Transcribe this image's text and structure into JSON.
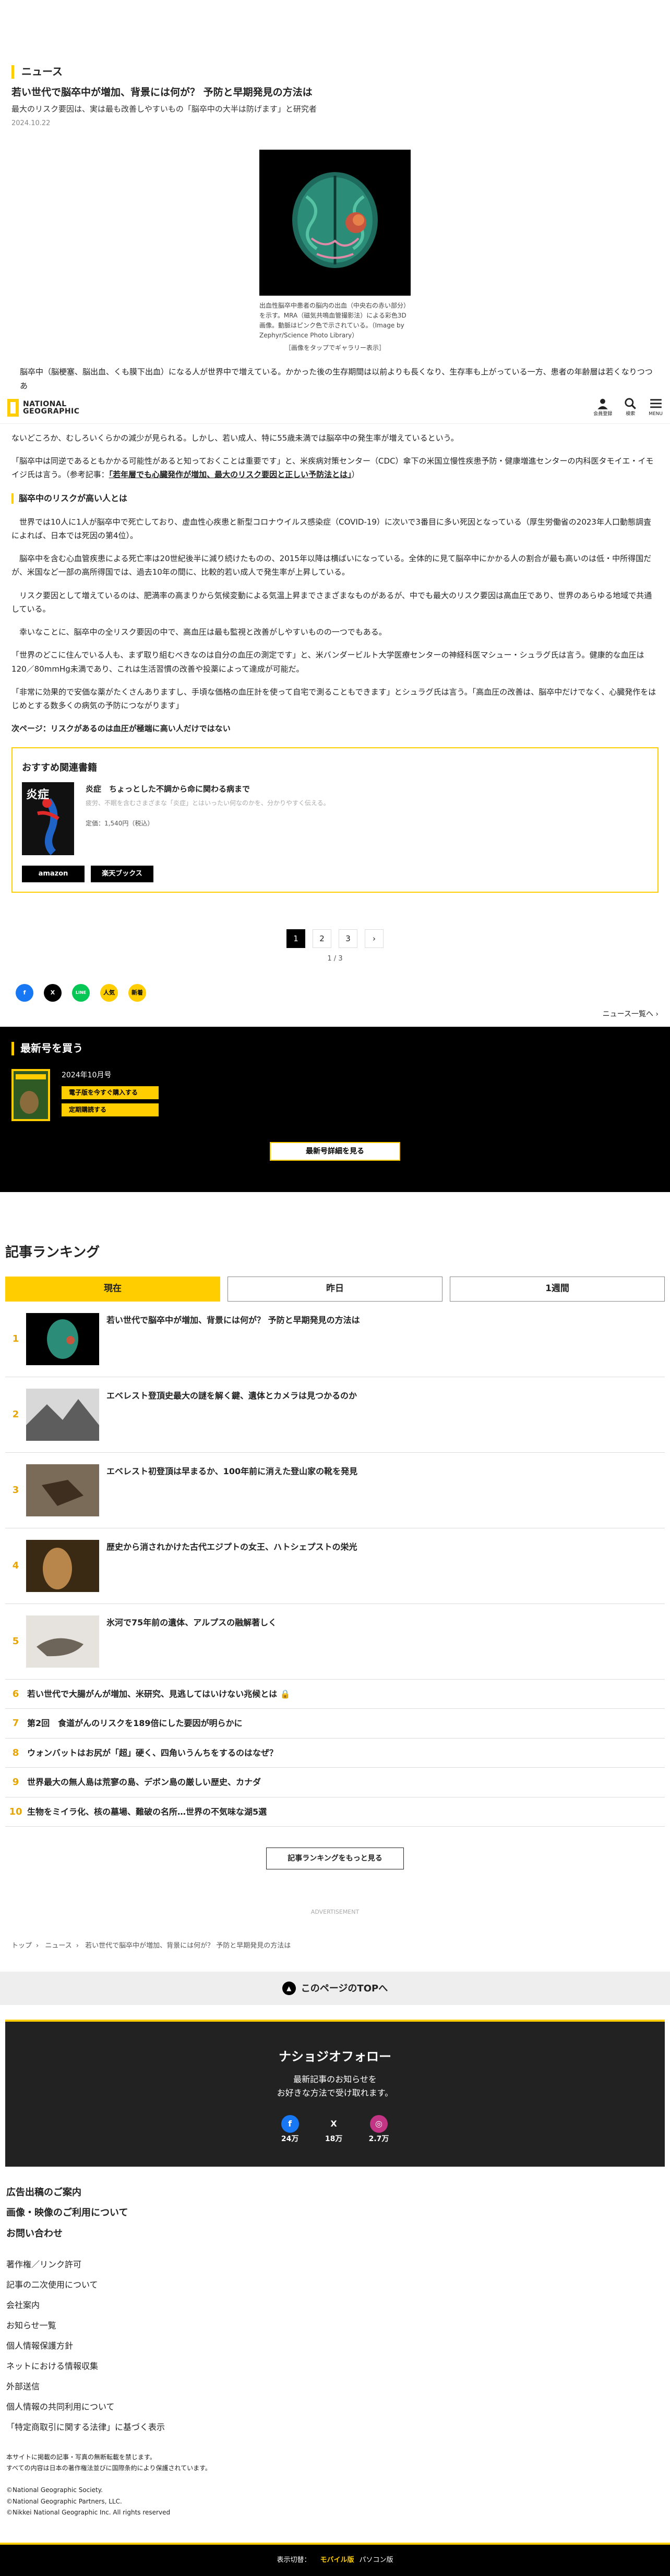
{
  "section_label": "ニュース",
  "article": {
    "title": "若い世代で脳卒中が増加、背景には何が？ 予防と早期発見の方法は",
    "subtitle": "最大のリスク要因は、実は最も改善しやすいもの「脳卒中の大半は防げます」と研究者",
    "date": "2024.10.22",
    "figure_caption": "出血性脳卒中患者の脳内の出血（中央右の赤い部分）を示す。MRA（磁気共鳴血管撮影法）による彩色3D画像。動脈はピンク色で示されている。（Image by Zephyr/Science Photo Library）",
    "figure_caption_2": "［画像をタップでギャラリー表示］",
    "lead": "脳卒中（脳梗塞、脳出血、くも膜下出血）になる人が世界中で増えている。かかった後の生存期間は以前よりも長くなり、生存率も上がっている一方、患者の年齢層は若くなりつつあ",
    "p1": "ないどころか、むしろいくらかの減少が見られる。しかし、若い成人、特に55歳未満では脳卒中の発生率が増えているという。",
    "p2_a": "「脳卒中は同逆であるともかかる可能性があると知っておくことは重要です」と、米疾病対策センター（CDC）傘下の米国立慢性疾患予防・健康増進センターの内科医タモイエ・イモイジ氏は言う。（参考記事：",
    "p2_link": "「若年層でも心臓発作が増加、最大のリスク要因と正しい予防法とは」",
    "p2_b": "）",
    "p3": "世界では10人に1人が脳卒中で死亡しており、虚血性心疾患と新型コロナウイルス感染症（COVID-19）に次いで3番目に多い死因となっている（厚生労働省の2023年人口動態調査によれば、日本では死因の第4位）。",
    "p4": "脳卒中を含む心血管疾患による死亡率は20世紀後半に減り続けたものの、2015年以降は横ばいになっている。全体的に見て脳卒中にかかる人の割合が最も高いのは低・中所得国だが、米国など一部の高所得国では、過去10年の間に、比較的若い成人で発生率が上昇している。",
    "p5": "リスク要因として増えているのは、肥満率の高まりから気候変動による気温上昇までさまざまなものがあるが、中でも最大のリスク要因は高血圧であり、世界のあらゆる地域で共通している。",
    "sub_heading": "脳卒中のリスクが高い人とは",
    "p6": "幸いなことに、脳卒中の全リスク要因の中で、高血圧は最も監視と改善がしやすいものの一つでもある。",
    "p7": "「世界のどこに住んでいる人も、まず取り組むべきなのは自分の血圧の測定です」と、米バンダービルト大学医療センターの神経科医マシュー・シュラグ氏は言う。健康的な血圧は120／80mmHg未満であり、これは生活習慣の改善や投薬によって達成が可能だ。",
    "p8": "「非常に効果的で安価な薬がたくさんありますし、手頃な価格の血圧計を使って自宅で測ることもできます」とシュラグ氏は言う。「高血圧の改善は、脳卒中だけでなく、心臓発作をはじめとする数多くの病気の予防につながります」",
    "next_page": "次ページ：リスクがあるのは血圧が極端に高い人だけではない"
  },
  "nav": {
    "logo_line1": "NATIONAL",
    "logo_line2": "GEOGRAPHIC",
    "member_label": "会員登録",
    "search_label": "検索",
    "menu_label": "MENU"
  },
  "book": {
    "heading": "おすすめ関連書籍",
    "title": "炎症　ちょっとした不調から命に関わる病まで",
    "desc": "疲労、不眠を含むさまざまな「炎症」とはいったい何なのかを、分かりやすく伝える。",
    "price": "定価：1,540円（税込）",
    "cover_title": "炎症",
    "btn_amazon": "amazon",
    "btn_rakuten": "楽天ブックス"
  },
  "pager": {
    "pages": [
      "1",
      "2",
      "3"
    ],
    "next": "›",
    "count": "1 / 3"
  },
  "share": {
    "facebook": "f",
    "x": "X",
    "line": "LINE",
    "hatena": "B!",
    "hatena_label": "人気",
    "pocket_label": "新着"
  },
  "news_list": "ニュース一覧へ ›",
  "latest_issue": {
    "heading": "最新号を買う",
    "month": "2024年10月号",
    "btn_buy": "電子版を今すぐ購入する",
    "btn_sub": "定期購読する",
    "btn_detail": "最新号詳細を見る"
  },
  "ranking": {
    "heading": "記事ランキング",
    "tabs": [
      "現在",
      "昨日",
      "1週間"
    ],
    "items": [
      {
        "num": "1",
        "title": "若い世代で脳卒中が増加、背景には何が？ 予防と早期発見の方法は"
      },
      {
        "num": "2",
        "title": "エベレスト登頂史最大の謎を解く鍵、遺体とカメラは見つかるのか"
      },
      {
        "num": "3",
        "title": "エベレスト初登頂は早まるか、100年前に消えた登山家の靴を発見"
      },
      {
        "num": "4",
        "title": "歴史から消されかけた古代エジプトの女王、ハトシェプストの栄光"
      },
      {
        "num": "5",
        "title": "氷河で75年前の遺体、アルプスの融解著しく"
      },
      {
        "num": "6",
        "title": "若い世代で大腸がんが増加、米研究、見逃してはいけない兆候とは"
      },
      {
        "num": "7",
        "title": "第2回　食道がんのリスクを189倍にした要因が明らかに"
      },
      {
        "num": "8",
        "title": "ウォンバットはお尻が「超」硬く、四角いうんちをするのはなぜ？"
      },
      {
        "num": "9",
        "title": "世界最大の無人島は荒寥の島、デボン島の厳しい歴史、カナダ"
      },
      {
        "num": "10",
        "title": "生物をミイラ化、核の墓場、難破の名所…世界の不気味な湖5選"
      }
    ],
    "more": "記事ランキングをもっと見る"
  },
  "advertisement": "ADVERTISEMENT",
  "breadcrumb": [
    "トップ",
    "ニュース",
    "若い世代で脳卒中が増加、背景には何が？ 予防と早期発見の方法は"
  ],
  "to_top": "このページのTOPへ",
  "follow": {
    "heading": "ナショジオフォロー",
    "line1": "最新記事のお知らせを",
    "line2": "お好きな方法で受け取れます。",
    "facebook_count": "24万",
    "x_count": "18万",
    "instagram_count": "2.7万"
  },
  "footer": {
    "big_links": [
      "広告出稿のご案内",
      "画像・映像のご利用について",
      "お問い合わせ"
    ],
    "links": [
      "著作権／リンク許可",
      "記事の二次使用について",
      "会社案内",
      "お知らせ一覧",
      "個人情報保護方針",
      "ネットにおける情報収集",
      "外部送信",
      "個人情報の共同利用について",
      "「特定商取引に関する法律」に基づく表示"
    ],
    "note1": "本サイトに掲載の記事・写真の無断転載を禁じます。",
    "note2": "すべての内容は日本の著作権法並びに国際条約により保護されています。",
    "copy": [
      "©National Geographic Society.",
      "©National Geographic Partners, LLC.",
      "©Nikkei National Geographic Inc. All rights reserved"
    ],
    "display_label": "表示切替：",
    "mobile": "モバイル版",
    "pc": "パソコン版"
  }
}
